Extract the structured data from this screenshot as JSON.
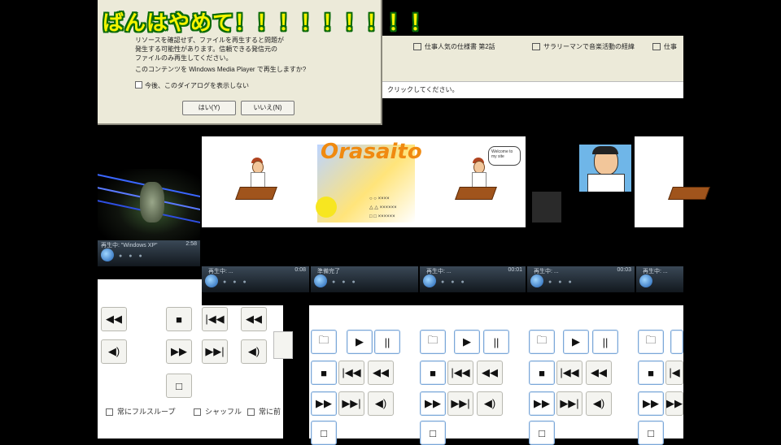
{
  "banner": {
    "text": "ばんはやめて！！！！！！！！！"
  },
  "dialog": {
    "line1": "リソースを確認せず、ファイルを再生すると問題が",
    "line2": "発生する可能性があります。信頼できる発信元の",
    "line3": "ファイルのみ再生してください。",
    "question": "このコンテンツを Windows Media Player で再生しますか?",
    "checkbox_label": "今後、このダイアログを表示しない",
    "yes_label": "はい(Y)",
    "no_label": "いいえ(N)"
  },
  "browser_bar": {
    "tabs": [
      "仕事人気の仕様書 第2話",
      "サラリーマンで音楽活動の経緯",
      "仕事"
    ],
    "hint": "クリックしてください。"
  },
  "website": {
    "logo": "Orasaito",
    "speech": "Welcome to my site",
    "info": [
      "○ ○ ××××",
      "△ △ ××××××",
      "□ □ ××××××"
    ]
  },
  "players": [
    {
      "label": "再生中: \"Windows XP\"",
      "time": "2:58"
    },
    {
      "label": "再生中: ...",
      "time": "0:08"
    },
    {
      "label": "準備完了",
      "time": ""
    },
    {
      "label": "再生中: ...",
      "time": "00:01"
    },
    {
      "label": "再生中: ...",
      "time": "00:03"
    },
    {
      "label": "再生中: ...",
      "time": ""
    }
  ],
  "controls": {
    "open": "open-folder-icon",
    "play": "play-icon",
    "pause": "pause-icon",
    "stop": "stop-icon",
    "prev": "skip-back-icon",
    "rewind": "rewind-icon",
    "ffwd": "fast-forward-icon",
    "next": "skip-forward-icon",
    "volume": "volume-icon",
    "fullscreen": "fullscreen-icon"
  },
  "options": {
    "repeat": "常にフルスループ",
    "shuffle": "シャッフル",
    "always_on_top": "常に前"
  }
}
